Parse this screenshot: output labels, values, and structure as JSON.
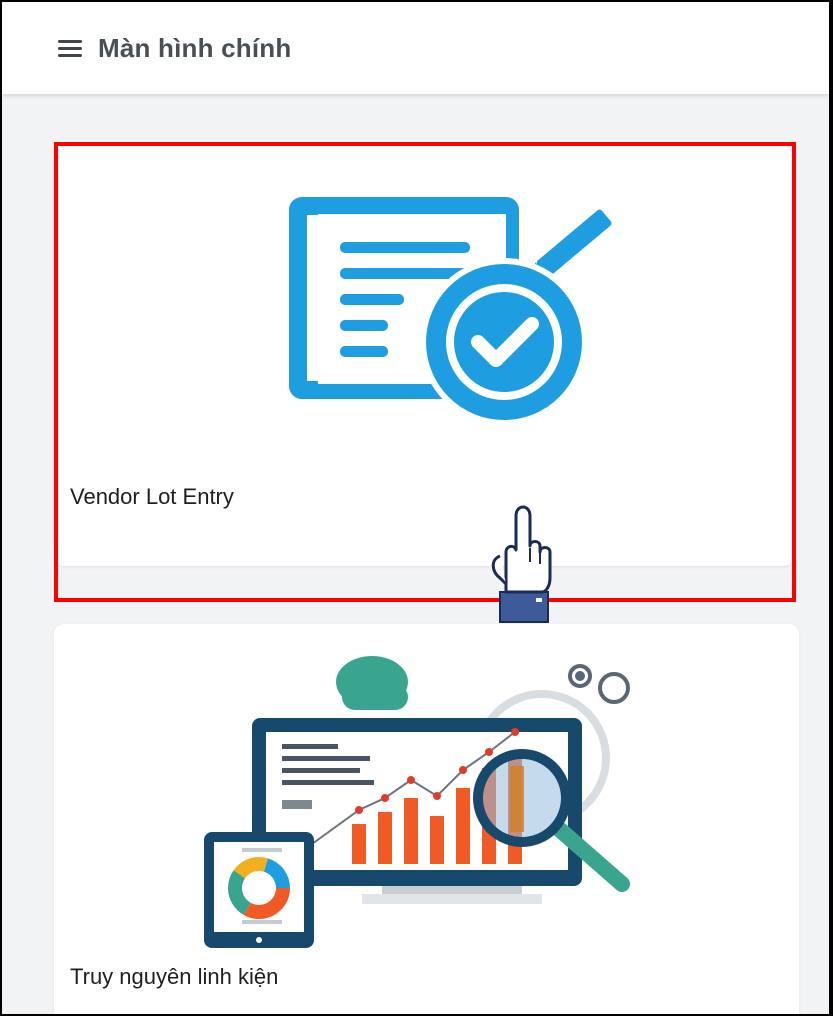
{
  "header": {
    "menu_icon": "hamburger-menu-icon",
    "title": "Màn hình chính"
  },
  "cards": [
    {
      "label": "Vendor Lot Entry",
      "icon": "document-check-icon"
    },
    {
      "label": "Truy nguyên linh kiện",
      "icon": "analytics-dashboard-icon"
    }
  ],
  "overlay": {
    "highlight_color": "#ff0000",
    "pointer_icon": "hand-pointer-icon"
  },
  "colors": {
    "accent_blue": "#1e9ee0",
    "title_text": "#4a4f55",
    "chart_orange": "#f05a24",
    "cloud_green": "#3aa58f"
  }
}
